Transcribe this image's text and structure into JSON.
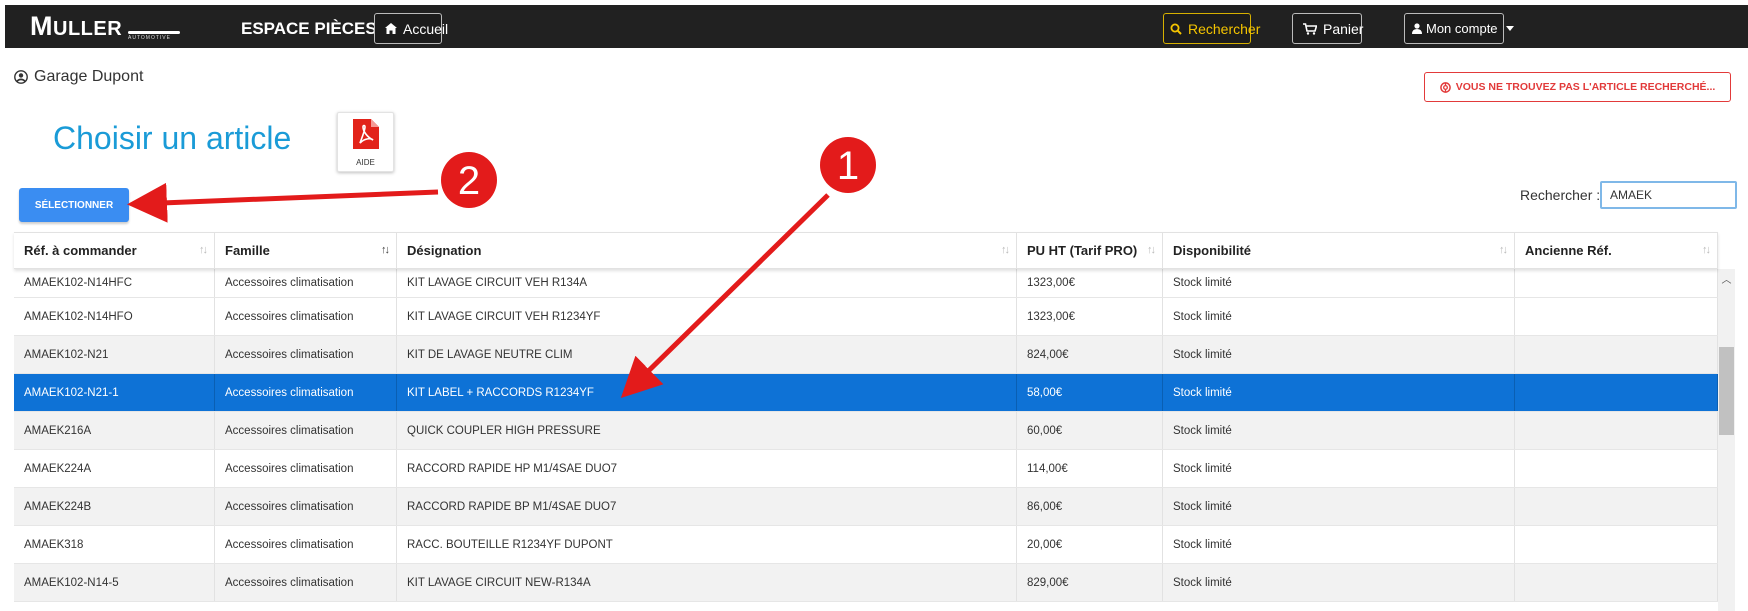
{
  "brand": {
    "name_initial": "M",
    "name_rest": "ULLER",
    "tagline": "AUTOMOTIVE"
  },
  "navbar": {
    "title": "ESPACE PIÈCES",
    "home_label": "Accueil",
    "search_label": "Rechercher",
    "cart_label": "Panier",
    "account_label": "Mon compte"
  },
  "user": {
    "name": "Garage Dupont"
  },
  "alert_button": {
    "label": "VOUS NE TROUVEZ PAS L'ARTICLE RECHERCHÉ..."
  },
  "page": {
    "title": "Choisir un article",
    "help_label": "AIDE"
  },
  "select_button": {
    "label": "SÉLECTIONNER"
  },
  "search": {
    "label": "Rechercher :",
    "value": "AMAEK"
  },
  "table": {
    "columns": [
      "Réf. à commander",
      "Famille",
      "Désignation",
      "PU HT (Tarif PRO)",
      "Disponibilité",
      "Ancienne Réf."
    ],
    "rows": [
      {
        "ref": "AMAEK102-N14HFC",
        "famille": "Accessoires climatisation",
        "designation": "KIT LAVAGE CIRCUIT VEH R134A",
        "prix": "1323,00€",
        "dispo": "Stock limité",
        "ancienne": ""
      },
      {
        "ref": "AMAEK102-N14HFO",
        "famille": "Accessoires climatisation",
        "designation": "KIT LAVAGE CIRCUIT VEH R1234YF",
        "prix": "1323,00€",
        "dispo": "Stock limité",
        "ancienne": ""
      },
      {
        "ref": "AMAEK102-N21",
        "famille": "Accessoires climatisation",
        "designation": "KIT DE LAVAGE NEUTRE CLIM",
        "prix": "824,00€",
        "dispo": "Stock limité",
        "ancienne": ""
      },
      {
        "ref": "AMAEK102-N21-1",
        "famille": "Accessoires climatisation",
        "designation": "KIT LABEL + RACCORDS R1234YF",
        "prix": "58,00€",
        "dispo": "Stock limité",
        "ancienne": ""
      },
      {
        "ref": "AMAEK216A",
        "famille": "Accessoires climatisation",
        "designation": "QUICK COUPLER HIGH PRESSURE",
        "prix": "60,00€",
        "dispo": "Stock limité",
        "ancienne": ""
      },
      {
        "ref": "AMAEK224A",
        "famille": "Accessoires climatisation",
        "designation": "RACCORD RAPIDE HP M1/4SAE DUO7",
        "prix": "114,00€",
        "dispo": "Stock limité",
        "ancienne": ""
      },
      {
        "ref": "AMAEK224B",
        "famille": "Accessoires climatisation",
        "designation": "RACCORD RAPIDE BP M1/4SAE DUO7",
        "prix": "86,00€",
        "dispo": "Stock limité",
        "ancienne": ""
      },
      {
        "ref": "AMAEK318",
        "famille": "Accessoires climatisation",
        "designation": "RACC. BOUTEILLE R1234YF DUPONT",
        "prix": "20,00€",
        "dispo": "Stock limité",
        "ancienne": ""
      },
      {
        "ref": "AMAEK102-N14-5",
        "famille": "Accessoires climatisation",
        "designation": "KIT LAVAGE CIRCUIT NEW-R134A",
        "prix": "829,00€",
        "dispo": "Stock limité",
        "ancienne": ""
      }
    ],
    "selected_index": 3
  },
  "annotations": {
    "marker_1": "1",
    "marker_2": "2"
  },
  "colors": {
    "accent": "#1a9bd7",
    "selected_row": "#0e72d6",
    "annotation": "#e31b1b",
    "navbar": "#212121"
  }
}
